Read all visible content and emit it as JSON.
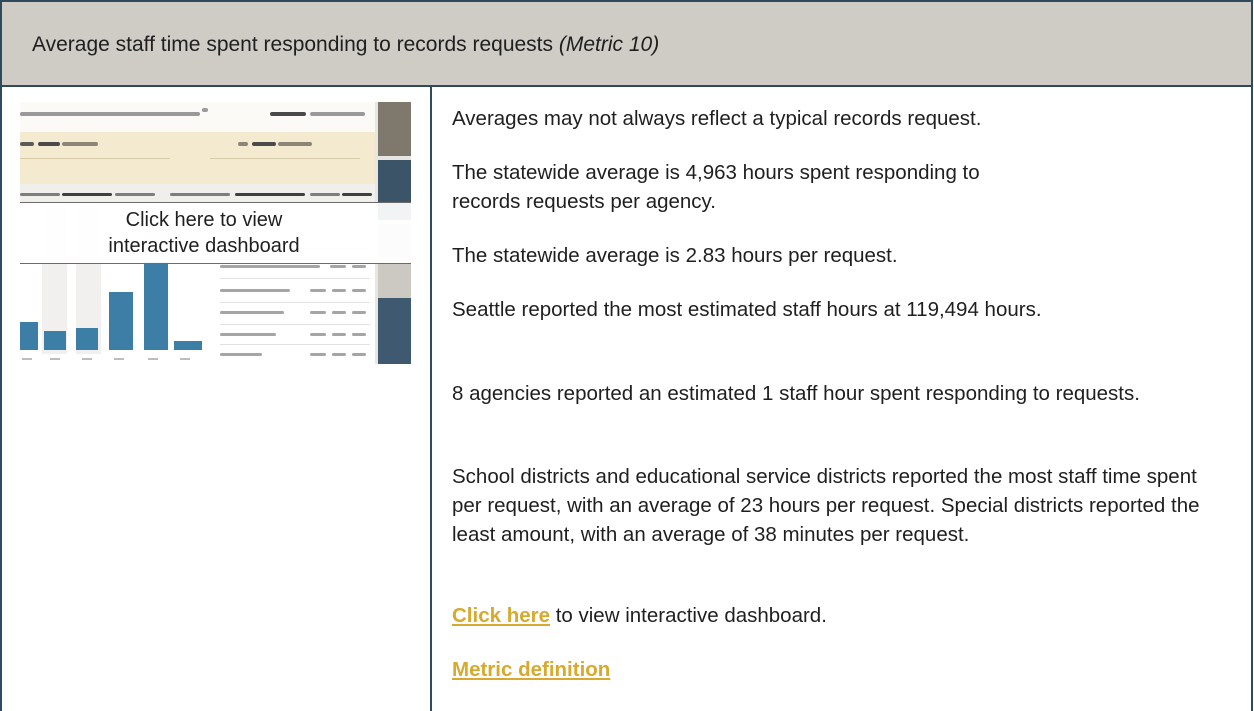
{
  "header": {
    "title": "Average staff time spent responding to records requests",
    "metric": "(Metric 10)"
  },
  "thumbnail": {
    "overlay_label": "Click here to view interactive dashboard"
  },
  "content": {
    "p1": "Averages may not always reflect a typical records request.",
    "p2": "The statewide average is 4,963 hours spent responding to records requests per agency.",
    "p3": "The statewide average is 2.83 hours per request.",
    "p4": "Seattle reported the most estimated staff hours at 119,494 hours.",
    "p5": "8 agencies reported an estimated 1 staff hour spent responding to requests.",
    "p6": "School districts and educational service districts reported the most staff time spent per request, with an average of 23 hours per request. Special districts reported the least amount, with an average of 38 minutes per request.",
    "p7_link": "Click here",
    "p7_rest": " to view interactive dashboard.",
    "p8_link": "Metric definition"
  },
  "colors": {
    "header_bg": "#cfcbc5",
    "border": "#2e4a5c",
    "link": "#d8a92d",
    "bar": "#3d7ea6"
  }
}
